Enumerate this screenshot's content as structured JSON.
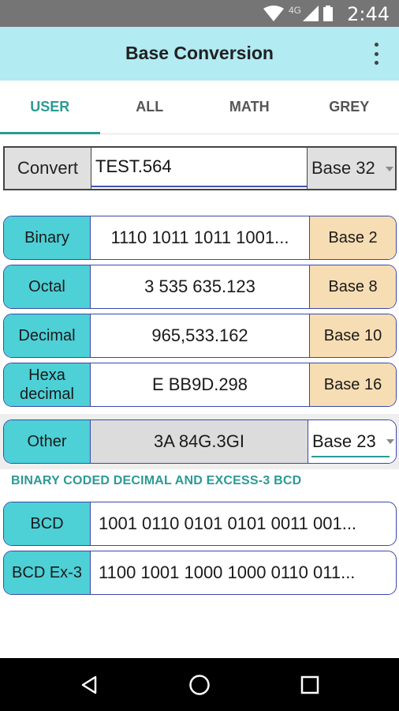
{
  "status_bar": {
    "network_label": "4G",
    "time": "2:44",
    "icons": [
      "wifi-icon",
      "cellular-signal-icon",
      "battery-icon"
    ]
  },
  "app_bar": {
    "title": "Base Conversion",
    "menu_icon": "overflow-menu-icon"
  },
  "tabs": [
    {
      "label": "USER",
      "active": true
    },
    {
      "label": "ALL",
      "active": false
    },
    {
      "label": "MATH",
      "active": false
    },
    {
      "label": "GREY",
      "active": false
    }
  ],
  "convert": {
    "label": "Convert",
    "input_value": "TEST.564",
    "base": "Base 32"
  },
  "conversions": [
    {
      "label": "Binary",
      "value": "1110 1011 1011 1001...",
      "base": "Base 2"
    },
    {
      "label": "Octal",
      "value": "3 535 635.123",
      "base": "Base 8"
    },
    {
      "label": "Decimal",
      "value": "965,533.162",
      "base": "Base 10"
    },
    {
      "label_line1": "Hexa",
      "label_line2": "decimal",
      "value": "E BB9D.298",
      "base": "Base 16"
    }
  ],
  "other": {
    "label": "Other",
    "value": "3A 84G.3GI",
    "base": "Base 23"
  },
  "bcd_section": {
    "heading": "BINARY CODED DECIMAL AND EXCESS-3 BCD",
    "rows": [
      {
        "label": "BCD",
        "value": "1001 0110 0101 0101 0011 001..."
      },
      {
        "label": "BCD Ex-3",
        "value": "1100 1001 1000 1000 0110 011..."
      }
    ]
  },
  "colors": {
    "status_bar": "#757575",
    "app_bar": "#b2ebf2",
    "accent": "#2c9a94",
    "label_cell": "#4dd0d6",
    "base_cell": "#f7ddb3",
    "row_border": "#3949ab"
  },
  "nav_bar": {
    "buttons": [
      "back-icon",
      "home-icon",
      "recents-icon"
    ]
  }
}
